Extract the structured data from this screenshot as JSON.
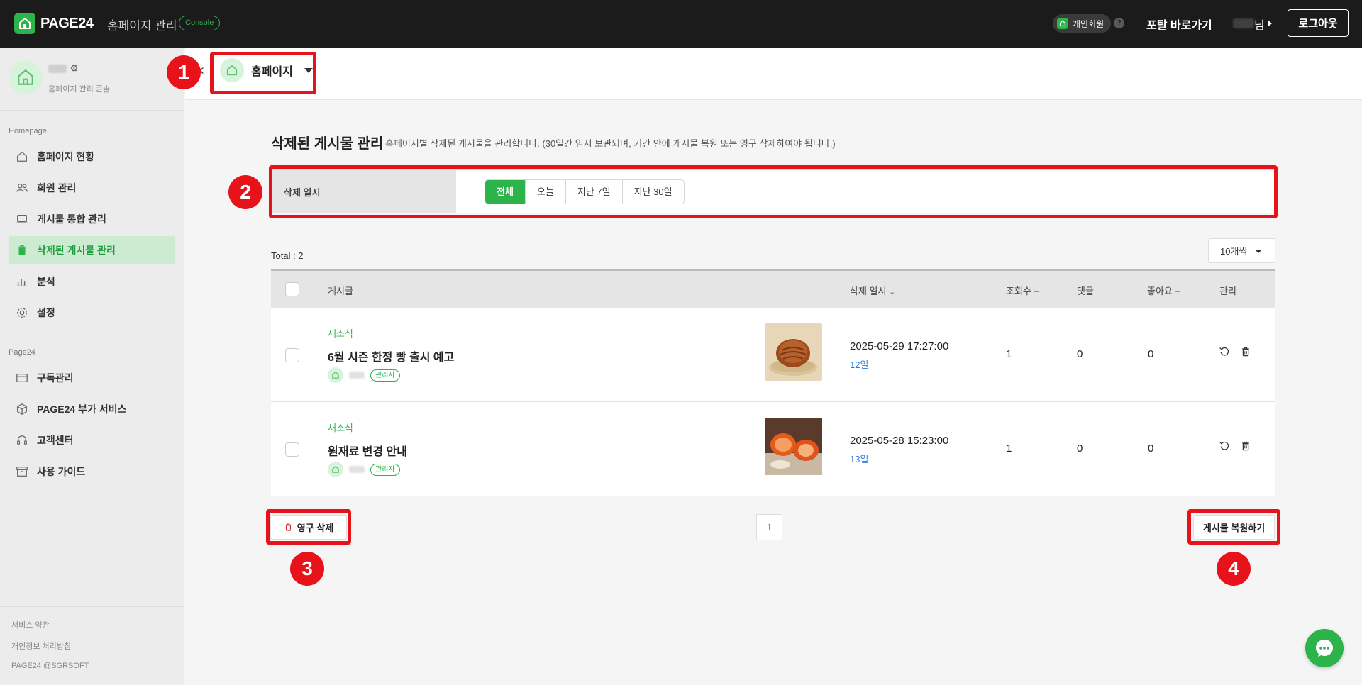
{
  "topbar": {
    "brand": "PAGE24",
    "app_title": "홈페이지 관리",
    "console_badge": "Console",
    "member_badge": "개인회원",
    "help": "?",
    "portal_link": "포탈 바로가기",
    "user_suffix": "님",
    "logout": "로그아웃"
  },
  "sidebar": {
    "profile_sub": "홈페이지 관리 콘솔",
    "section_homepage": "Homepage",
    "items_homepage": [
      {
        "label": "홈페이지 현황",
        "icon": "home-icon"
      },
      {
        "label": "회원 관리",
        "icon": "users-icon"
      },
      {
        "label": "게시물 통합 관리",
        "icon": "board-icon"
      },
      {
        "label": "삭제된 게시물 관리",
        "icon": "trash-icon",
        "active": true
      },
      {
        "label": "분석",
        "icon": "chart-icon"
      },
      {
        "label": "설정",
        "icon": "gear-icon"
      }
    ],
    "section_page24": "Page24",
    "items_page24": [
      {
        "label": "구독관리",
        "icon": "card-icon"
      },
      {
        "label": "PAGE24 부가 서비스",
        "icon": "box-icon"
      },
      {
        "label": "고객센터",
        "icon": "headset-icon"
      },
      {
        "label": "사용 가이드",
        "icon": "archive-icon"
      }
    ],
    "footer": [
      "서비스 약관",
      "개인정보 처리방침",
      "PAGE24 @SGRSOFT"
    ]
  },
  "site_selector": {
    "label": "홈페이지"
  },
  "page": {
    "title": "삭제된 게시물 관리",
    "description": "홈페이지별 삭제된 게시물을 관리합니다. (30일간 임시 보관되며, 기간 안에 게시물 복원 또는 영구 삭제하여야 됩니다.)"
  },
  "filter": {
    "label": "삭제 일시",
    "options": [
      "전체",
      "오늘",
      "지난 7일",
      "지난 30일"
    ],
    "selected": "전체"
  },
  "list": {
    "total": "Total : 2",
    "per_page": "10개씩",
    "headers": {
      "post": "게시글",
      "deleted_at": "삭제 일시",
      "views": "조회수",
      "comments": "댓글",
      "likes": "좋아요",
      "manage": "관리"
    },
    "rows": [
      {
        "category": "새소식",
        "title": "6월 시즌 한정 빵 출시 예고",
        "role": "관리자",
        "deleted_at": "2025-05-29 17:27:00",
        "remaining": "12일",
        "views": "1",
        "comments": "0",
        "likes": "0"
      },
      {
        "category": "새소식",
        "title": "원재료 변경 안내",
        "role": "관리자",
        "deleted_at": "2025-05-28 15:23:00",
        "remaining": "13일",
        "views": "1",
        "comments": "0",
        "likes": "0"
      }
    ]
  },
  "actions": {
    "permanent_delete": "영구 삭제",
    "restore": "게시물 복원하기",
    "page": "1"
  },
  "annotations": [
    "1",
    "2",
    "3",
    "4"
  ],
  "colors": {
    "accent": "#2cb34a",
    "annotation": "#e8121b",
    "topbar": "#1b1b1b"
  }
}
